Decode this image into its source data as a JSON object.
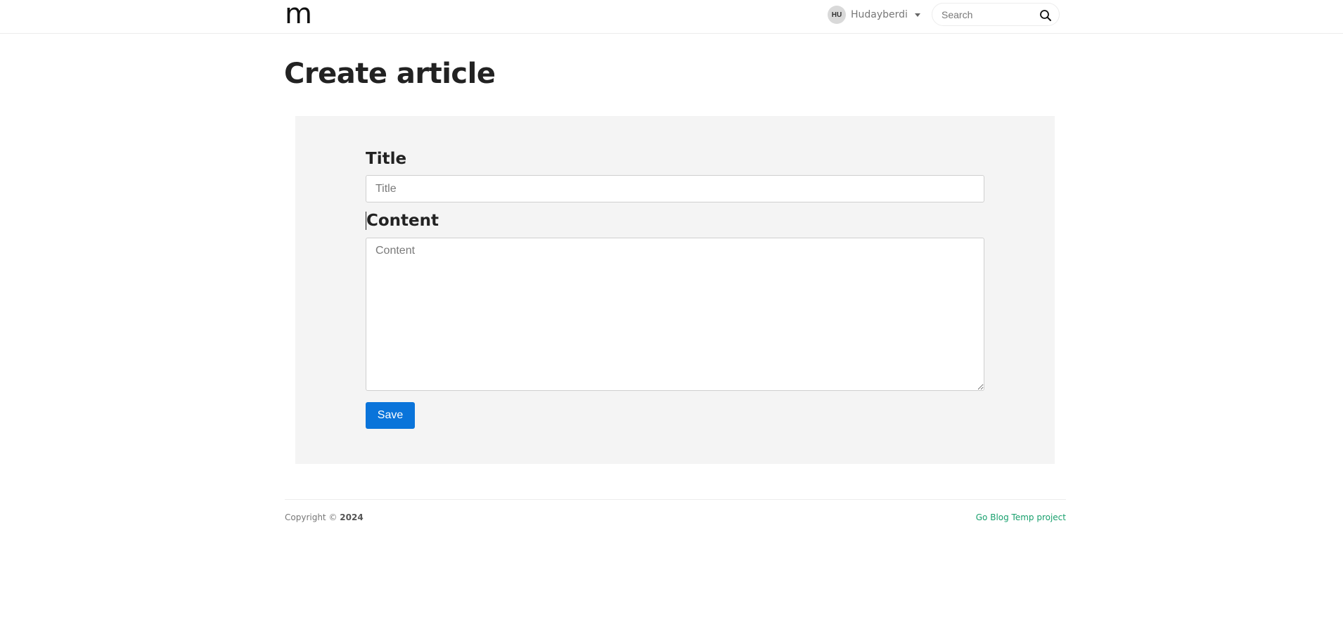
{
  "header": {
    "logo": "m",
    "user": {
      "initials": "HU",
      "name": "Hudayberdi"
    },
    "search": {
      "placeholder": "Search",
      "value": ""
    }
  },
  "page": {
    "title": "Create article"
  },
  "form": {
    "title_label": "Title",
    "title_placeholder": "Title",
    "title_value": "",
    "content_label": "Content",
    "content_placeholder": "Content",
    "content_value": "",
    "save_label": "Save"
  },
  "footer": {
    "copyright_prefix": "Copyright ©",
    "copyright_year": "2024",
    "link_label": "Go Blog Temp project"
  },
  "colors": {
    "primary_button": "#0a74da",
    "footer_link": "#18a06d",
    "panel_background": "#f4f4f4"
  }
}
